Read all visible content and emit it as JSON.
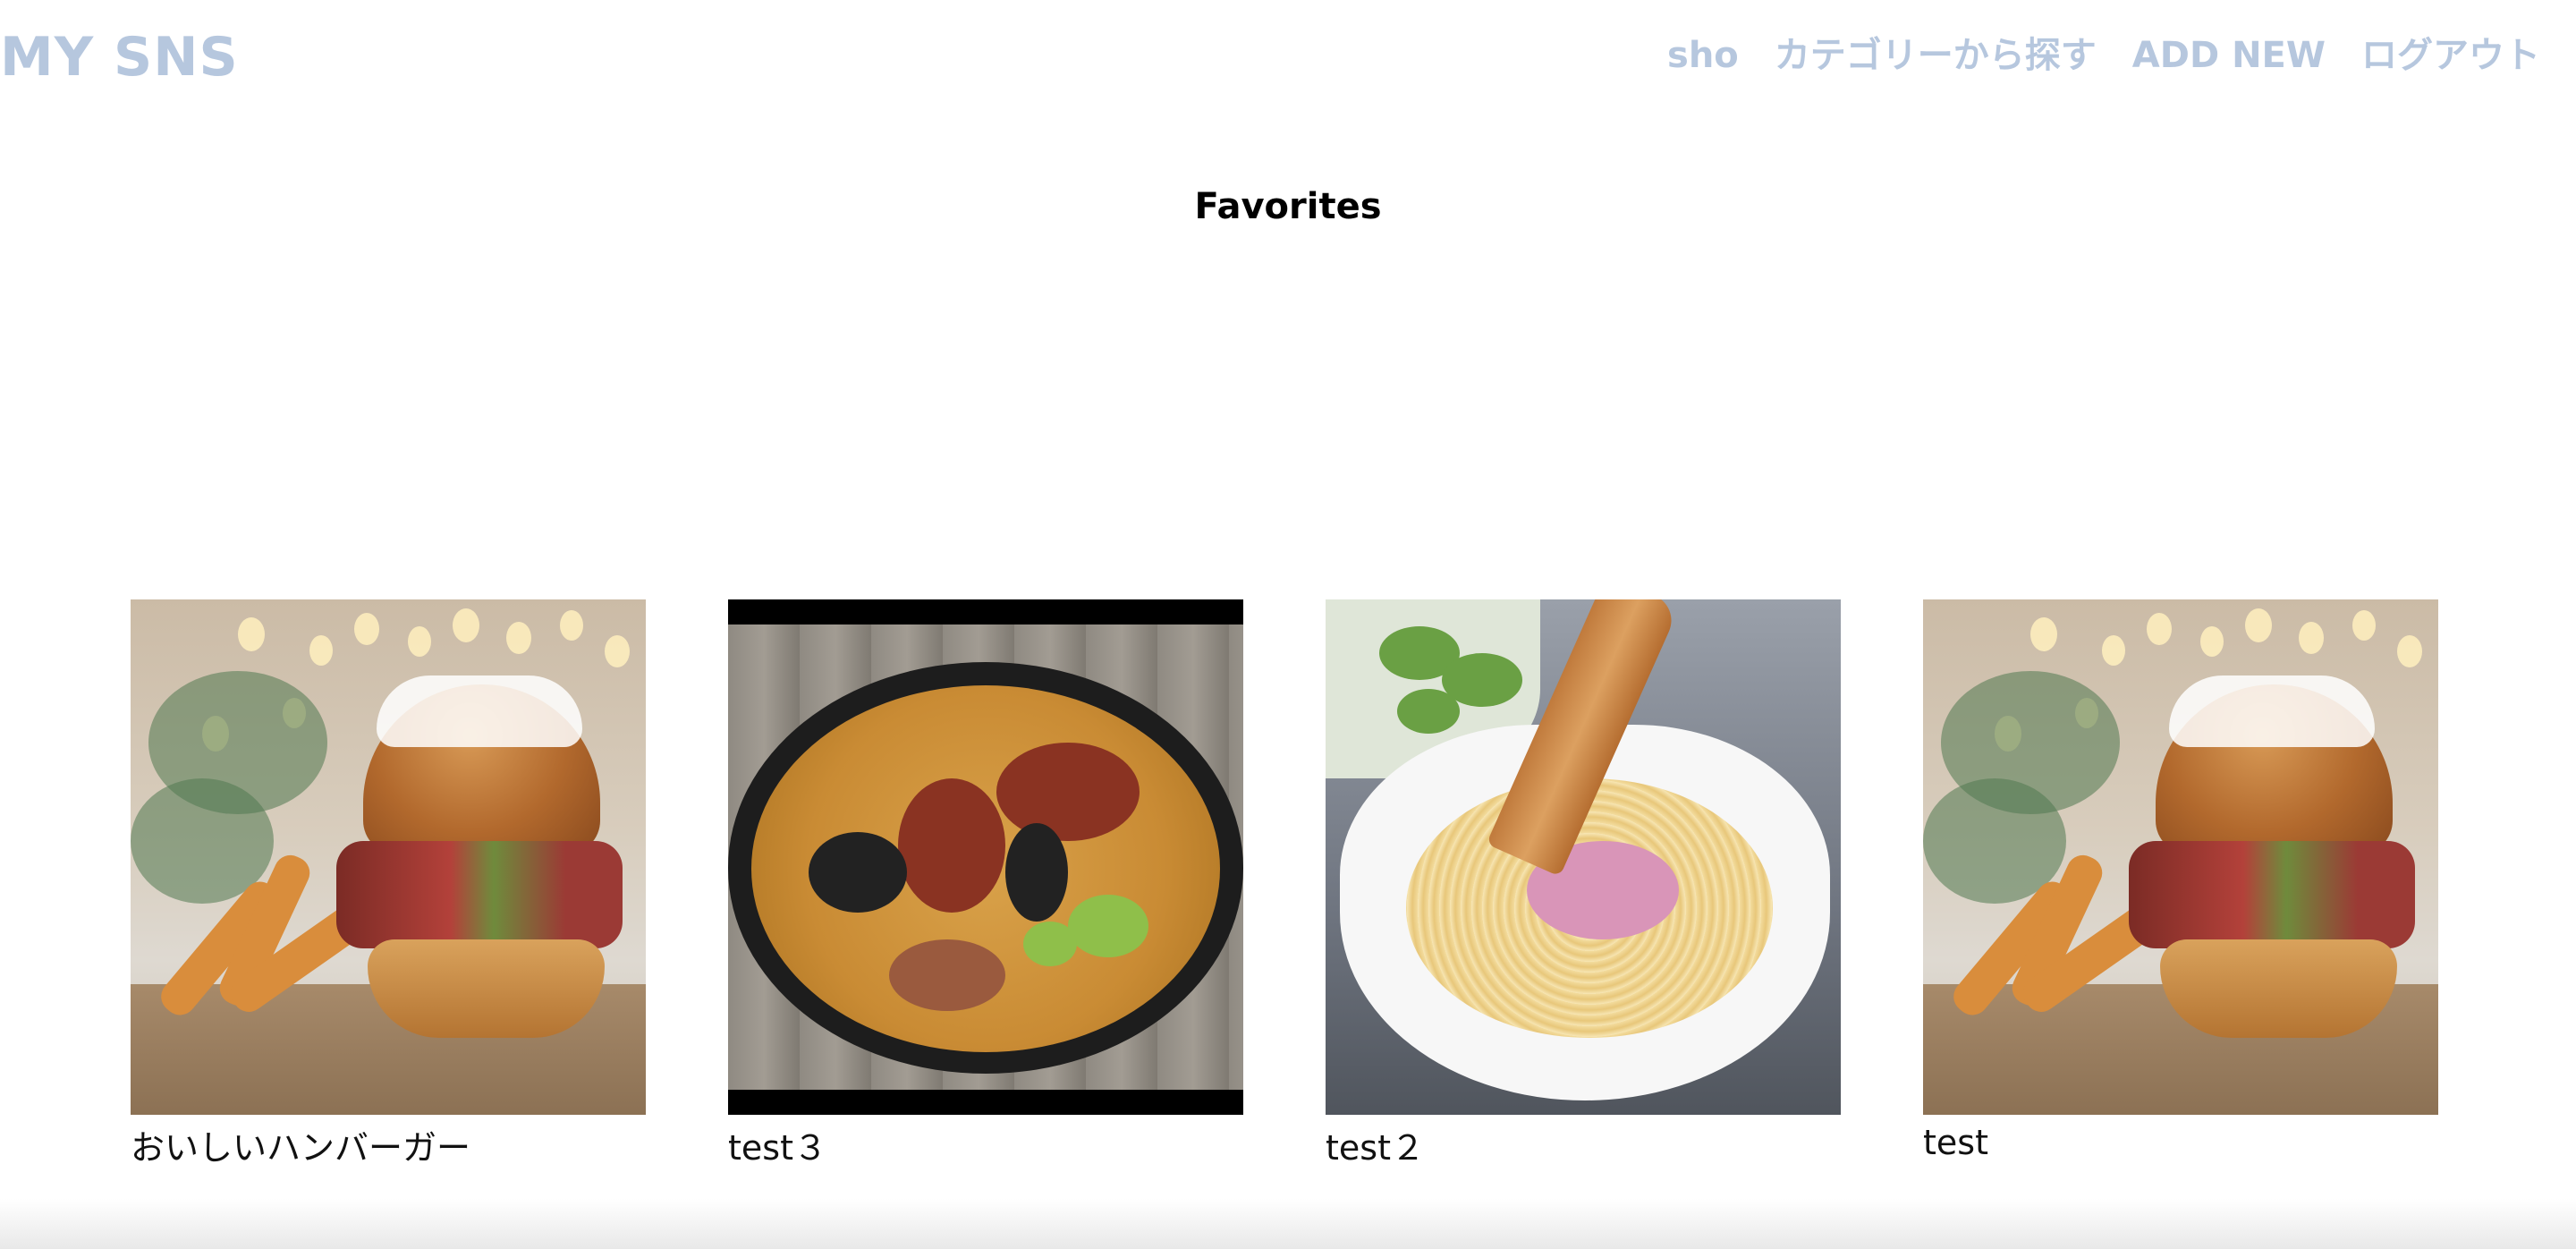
{
  "header": {
    "logo": "MY SNS",
    "nav": [
      {
        "label": "sho"
      },
      {
        "label": "カテゴリーから探す"
      },
      {
        "label": "ADD NEW"
      },
      {
        "label": "ログアウト"
      }
    ]
  },
  "page_title": "Favorites",
  "favorites": [
    {
      "title": "おいしいハンバーガー",
      "image": "burger-photo"
    },
    {
      "title": "test３",
      "image": "paella-photo"
    },
    {
      "title": "test２",
      "image": "pasta-photo"
    },
    {
      "title": "test",
      "image": "burger-photo"
    }
  ],
  "colors": {
    "nav_text": "#b6c7de",
    "title_text": "#000000",
    "background": "#ffffff"
  }
}
